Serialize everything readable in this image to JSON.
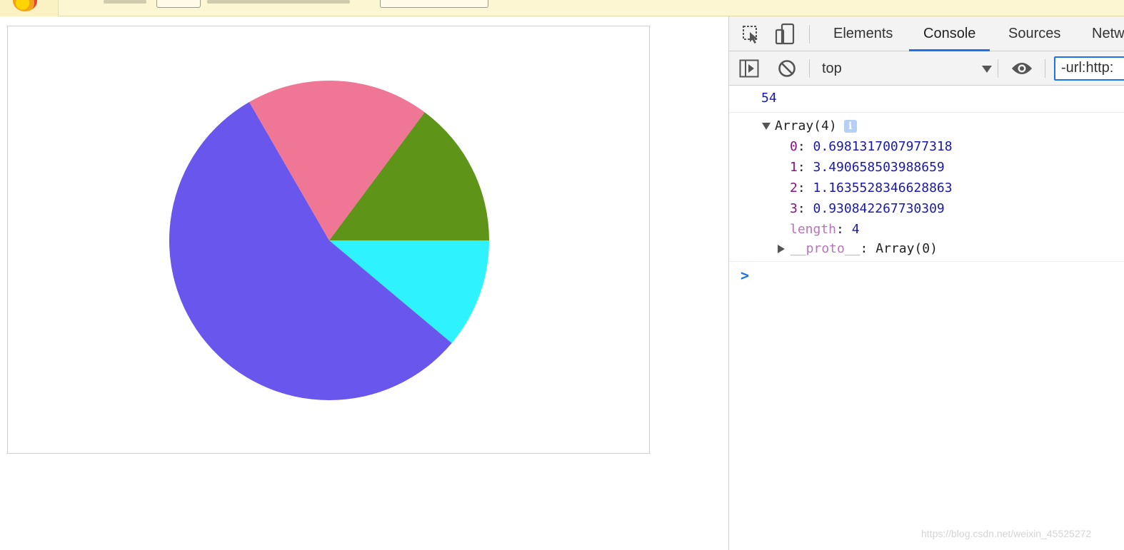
{
  "devtools": {
    "tabs": [
      {
        "label": "Elements",
        "active": false
      },
      {
        "label": "Console",
        "active": true
      },
      {
        "label": "Sources",
        "active": false
      },
      {
        "label": "Netw",
        "active": false
      }
    ],
    "context": "top",
    "filter_value": "-url:http:",
    "console": {
      "log_value": "54",
      "array_label": "Array(4)",
      "items": [
        {
          "index": "0",
          "value": "0.6981317007977318"
        },
        {
          "index": "1",
          "value": "3.490658503988659"
        },
        {
          "index": "2",
          "value": "1.1635528346628863"
        },
        {
          "index": "3",
          "value": "0.930842267730309"
        }
      ],
      "length_key": "length",
      "length_value": "4",
      "proto_key": "__proto__",
      "proto_value": "Array(0)",
      "prompt": ">"
    }
  },
  "chart_data": {
    "type": "pie",
    "values": [
      0.6981317007977318,
      3.490658503988659,
      1.1635528346628863,
      0.930842267730309
    ],
    "colors": [
      "#2ef2fe",
      "#6956ec",
      "#f07695",
      "#5e9518"
    ],
    "start_angle_direction": "clockwise-from-3-oclock"
  },
  "watermark": "https://blog.csdn.net/weixin_45525272"
}
